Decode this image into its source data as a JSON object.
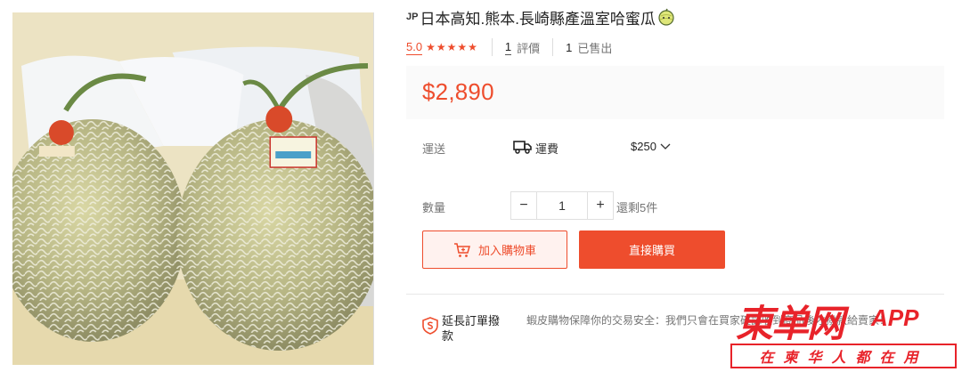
{
  "product": {
    "origin_flag": "JP",
    "title": "日本高知.熊本.長崎縣產溫室哈蜜瓜",
    "title_emoji": "melon-icon"
  },
  "rating": {
    "score": "5.0",
    "stars": 5,
    "review_count": "1",
    "review_label": "評價",
    "sold_count": "1",
    "sold_label": "已售出"
  },
  "price": "$2,890",
  "shipping": {
    "label": "運送",
    "fee_label": "運費",
    "fee": "$250"
  },
  "quantity": {
    "label": "數量",
    "minus": "−",
    "value": "1",
    "plus": "+",
    "stock": "還剩5件"
  },
  "buttons": {
    "add_to_cart": "加入購物車",
    "buy_now": "直接購買"
  },
  "guarantee": {
    "title": "延長訂單撥款",
    "text": "蝦皮購物保障你的交易安全：我們只會在買家確認收到商品後才撥款給賣家！"
  },
  "watermark": {
    "logo": "東单网",
    "app": "APP",
    "tagline": "在柬华人都在用"
  },
  "colors": {
    "accent": "#ee4d2d",
    "watermark": "#e8232a"
  }
}
